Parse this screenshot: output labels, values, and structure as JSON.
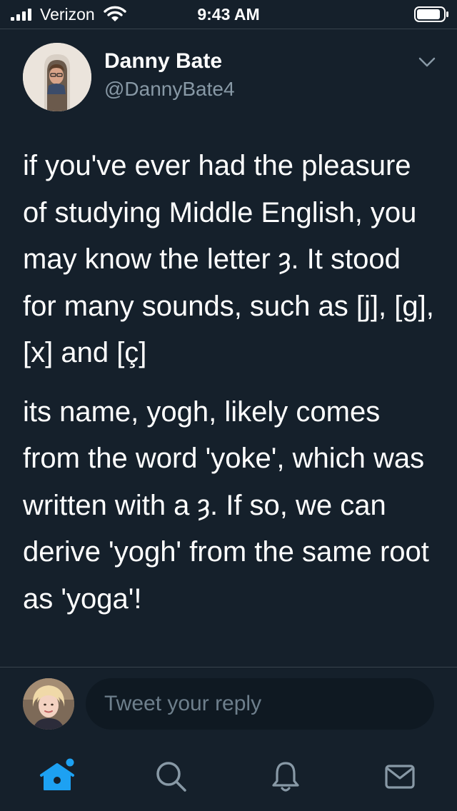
{
  "status_bar": {
    "carrier": "Verizon",
    "time": "9:43 AM",
    "signal_icon": "cellular-signal-icon",
    "wifi_icon": "wifi-icon",
    "battery_icon": "battery-icon"
  },
  "tweet": {
    "author_name": "Danny Bate",
    "author_handle": "@DannyBate4",
    "paragraphs": [
      "if you've ever had the pleasure of studying Middle English, you may know the letter ȝ. It stood for many sounds, such as [j], [g], [x] and [ç]",
      "its name, yogh, likely comes from the word 'yoke', which was written with a ȝ. If so, we can derive 'yogh' from the same root as 'yoga'!"
    ],
    "more_icon": "chevron-down-icon"
  },
  "reply": {
    "placeholder": "Tweet your reply"
  },
  "tab_bar": {
    "tabs": [
      {
        "icon": "home-icon",
        "active": true,
        "has_notification_dot": true
      },
      {
        "icon": "search-icon",
        "active": false
      },
      {
        "icon": "bell-icon",
        "active": false
      },
      {
        "icon": "mail-icon",
        "active": false
      }
    ]
  },
  "colors": {
    "background": "#15202b",
    "text_primary": "#ffffff",
    "text_secondary": "#8899a6",
    "accent": "#1da1f2",
    "divider": "#38444d",
    "input_background": "#0f1922"
  }
}
